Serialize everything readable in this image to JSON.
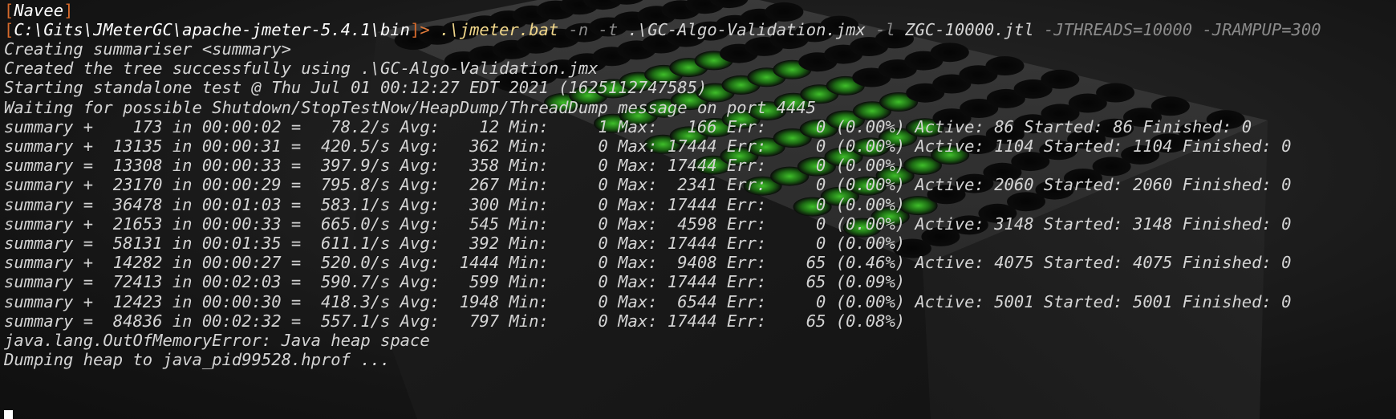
{
  "prompt": {
    "user": "Navee",
    "path": "C:\\Gits\\JMeterGC\\apache-jmeter-5.4.1\\bin",
    "caret": "> ",
    "command": ".\\jmeter.bat",
    "flag_n": "-n",
    "flag_t": "-t",
    "test_file": ".\\GC-Algo-Validation.jmx",
    "flag_l": "-l",
    "log_file": "ZGC-10000.jtl",
    "threads_arg": "-JTHREADS=10000",
    "rampup_arg": "-JRAMPUP=300"
  },
  "output": [
    "Creating summariser <summary>",
    "Created the tree successfully using .\\GC-Algo-Validation.jmx",
    "Starting standalone test @ Thu Jul 01 00:12:27 EDT 2021 (1625112747585)",
    "Waiting for possible Shutdown/StopTestNow/HeapDump/ThreadDump message on port 4445",
    "summary +    173 in 00:00:02 =   78.2/s Avg:    12 Min:     1 Max:   166 Err:     0 (0.00%) Active: 86 Started: 86 Finished: 0",
    "summary +  13135 in 00:00:31 =  420.5/s Avg:   362 Min:     0 Max: 17444 Err:     0 (0.00%) Active: 1104 Started: 1104 Finished: 0",
    "summary =  13308 in 00:00:33 =  397.9/s Avg:   358 Min:     0 Max: 17444 Err:     0 (0.00%)",
    "summary +  23170 in 00:00:29 =  795.8/s Avg:   267 Min:     0 Max:  2341 Err:     0 (0.00%) Active: 2060 Started: 2060 Finished: 0",
    "summary =  36478 in 00:01:03 =  583.1/s Avg:   300 Min:     0 Max: 17444 Err:     0 (0.00%)",
    "summary +  21653 in 00:00:33 =  665.0/s Avg:   545 Min:     0 Max:  4598 Err:     0 (0.00%) Active: 3148 Started: 3148 Finished: 0",
    "summary =  58131 in 00:01:35 =  611.1/s Avg:   392 Min:     0 Max: 17444 Err:     0 (0.00%)",
    "summary +  14282 in 00:00:27 =  520.0/s Avg:  1444 Min:     0 Max:  9408 Err:    65 (0.46%) Active: 4075 Started: 4075 Finished: 0",
    "summary =  72413 in 00:02:03 =  590.7/s Avg:   599 Min:     0 Max: 17444 Err:    65 (0.09%)",
    "summary +  12423 in 00:00:30 =  418.3/s Avg:  1948 Min:     0 Max:  6544 Err:     0 (0.00%) Active: 5001 Started: 5001 Finished: 0",
    "summary =  84836 in 00:02:32 =  557.1/s Avg:   797 Min:     0 Max: 17444 Err:    65 (0.08%)",
    "java.lang.OutOfMemoryError: Java heap space",
    "Dumping heap to java_pid99528.hprof ..."
  ]
}
